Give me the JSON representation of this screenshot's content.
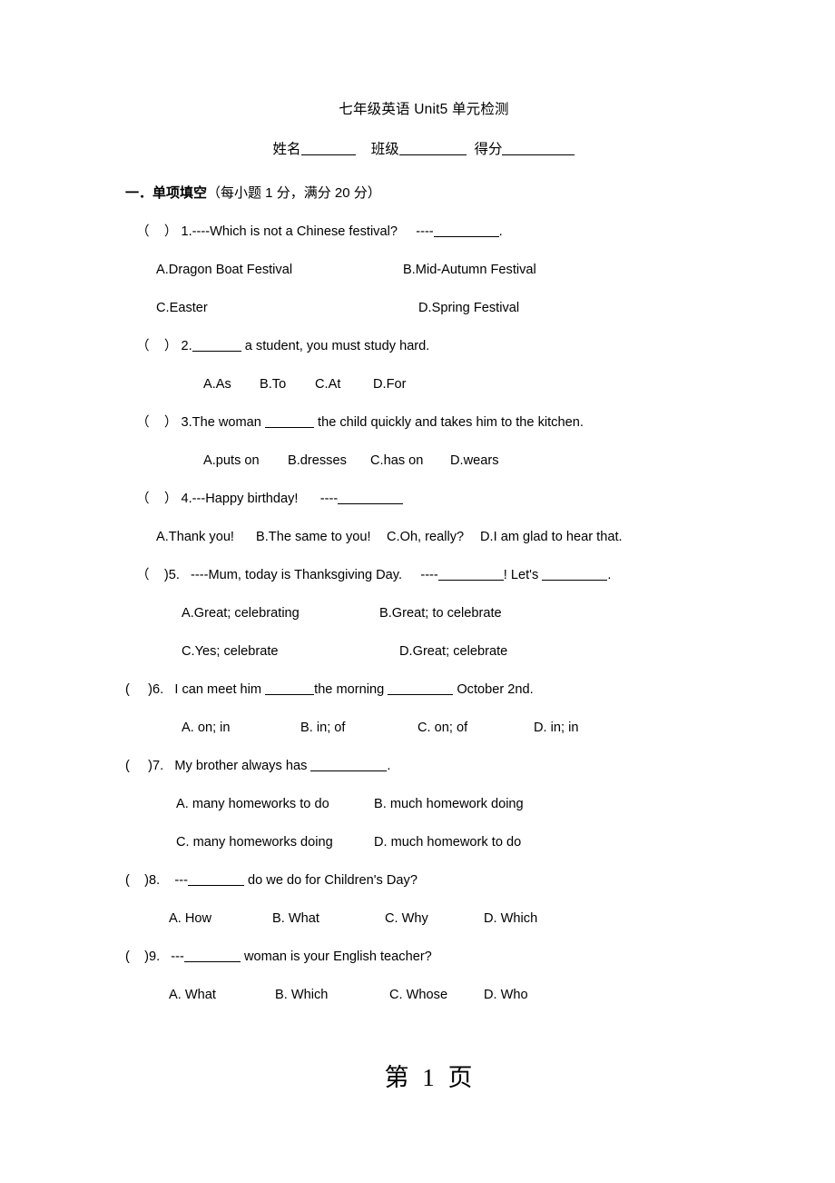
{
  "document": {
    "title": "七年级英语 Unit5 单元检测",
    "id_line": {
      "name_label": "姓名",
      "class_label": "班级",
      "score_label": "得分"
    },
    "section": {
      "label": "一．单项填空",
      "note": "（每小题 1 分，满分 20 分）"
    },
    "footer": "第 1 页"
  },
  "questions": [
    {
      "paren_open": "（",
      "paren_close": "）",
      "number": "1.",
      "stem_before": "----Which is not a Chinese festival?     ----",
      "stem_after": ".",
      "options": [
        "A.Dragon Boat Festival",
        "B.Mid-Autumn Festival",
        "C.Easter",
        "D.Spring Festival"
      ]
    },
    {
      "paren_open": "（",
      "paren_close": "）",
      "number": "2.",
      "stem_before": "",
      "stem_after": " a student, you must study hard.",
      "options": [
        "A.As",
        "B.To",
        "C.At",
        "D.For"
      ]
    },
    {
      "paren_open": "（",
      "paren_close": "）",
      "number": "3.",
      "stem_before": "The woman ",
      "stem_after": " the child quickly and takes him to the kitchen.",
      "options": [
        "A.puts on",
        "B.dresses",
        "C.has on",
        "D.wears"
      ]
    },
    {
      "paren_open": "（",
      "paren_close": "）",
      "number": "4.",
      "stem_before": "---Happy birthday!      ----",
      "stem_after": "",
      "options": [
        "A.Thank you!",
        "B.The same to you!",
        "C.Oh, really?",
        "D.I am glad to hear that."
      ]
    },
    {
      "paren_open": "（",
      "paren_close": ")",
      "number": "5.",
      "stem_before": "   ----Mum, today is Thanksgiving Day.     ----",
      "stem_mid": "! Let's ",
      "stem_after": ".",
      "options": [
        "A.Great; celebrating",
        "B.Great; to celebrate",
        "C.Yes; celebrate",
        "D.Great; celebrate"
      ]
    },
    {
      "paren_open": "(",
      "paren_close": ")",
      "number": "6.",
      "stem_before": "   I can meet him ",
      "stem_mid": "the morning ",
      "stem_after": " October 2nd.",
      "options": [
        "A. on; in",
        "B. in; of",
        "C. on; of",
        "D. in; in"
      ]
    },
    {
      "paren_open": "(",
      "paren_close": ")",
      "number": "7.",
      "stem_before": "   My brother always has ",
      "stem_after": ".",
      "options": [
        "A. many homeworks to do",
        "B. much homework doing",
        "C. many homeworks doing",
        "D. much homework to do"
      ]
    },
    {
      "paren_open": "(",
      "paren_close": ")",
      "number": "8.",
      "stem_before": "    ---",
      "stem_after": " do we do for Children's Day?",
      "options": [
        "A. How",
        "B. What",
        "C. Why",
        "D. Which"
      ]
    },
    {
      "paren_open": "(",
      "paren_close": ")",
      "number": "9.",
      "stem_before": "   ---",
      "stem_after": " woman is your English teacher?",
      "options": [
        "A. What",
        "B. Which",
        "C. Whose",
        "D. Who"
      ]
    }
  ]
}
